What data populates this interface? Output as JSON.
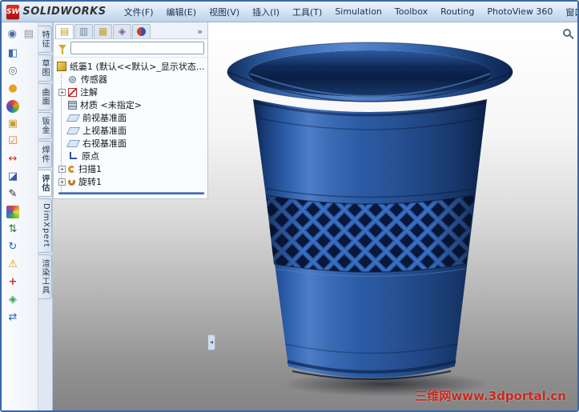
{
  "titlebar": {
    "logo_text": "SW",
    "brand": "SOLIDWORKS",
    "menus": [
      "文件(F)",
      "编辑(E)",
      "视图(V)",
      "插入(I)",
      "工具(T)",
      "Simulation",
      "Toolbox",
      "Routing",
      "PhotoView 360",
      "窗口(W)"
    ]
  },
  "left_toolbar": {
    "icons": [
      {
        "name": "pin-icon",
        "glyph": "◉"
      },
      {
        "name": "document-icon",
        "glyph": "▤"
      },
      {
        "name": "part-cube-icon",
        "glyph": "◧"
      },
      {
        "name": "target-icon",
        "glyph": "◎"
      },
      {
        "name": "appearance-icon",
        "glyph": "●"
      },
      {
        "name": "color-wheel-icon",
        "glyph": ""
      },
      {
        "name": "scene-icon",
        "glyph": "▣"
      },
      {
        "name": "options-check-icon",
        "glyph": "☑"
      },
      {
        "name": "measure-icon",
        "glyph": "↔"
      },
      {
        "name": "section-view-icon",
        "glyph": "◪"
      },
      {
        "name": "pen-icon",
        "glyph": "✎"
      },
      {
        "name": "palette-icon",
        "glyph": ""
      },
      {
        "name": "sort-arrows-icon",
        "glyph": "⇅"
      },
      {
        "name": "refresh-icon",
        "glyph": "↻"
      },
      {
        "name": "warning-icon",
        "glyph": "⚠"
      },
      {
        "name": "crosshair-icon",
        "glyph": "+"
      },
      {
        "name": "diamond-icon",
        "glyph": "◈"
      },
      {
        "name": "swap-icon",
        "glyph": "⇄"
      }
    ]
  },
  "command_tabs": {
    "items": [
      {
        "label": "特征"
      },
      {
        "label": "草图"
      },
      {
        "label": "曲面"
      },
      {
        "label": "钣金"
      },
      {
        "label": "焊件"
      },
      {
        "label": "评估"
      },
      {
        "label": "DimXpert"
      },
      {
        "label": "渲染工具"
      }
    ]
  },
  "feature_panel": {
    "tabs": [
      {
        "name": "featuremanager-tab",
        "glyph": "▤"
      },
      {
        "name": "propertymanager-tab",
        "glyph": "▥"
      },
      {
        "name": "configurationmanager-tab",
        "glyph": "▦"
      },
      {
        "name": "dimxpertmanager-tab",
        "glyph": "◈"
      },
      {
        "name": "displaymanager-tab",
        "glyph": ""
      }
    ],
    "overflow_glyph": "»",
    "filter": {
      "placeholder": ""
    },
    "tree": {
      "root": {
        "label": "纸篓1 (默认<<默认>_显示状态..."
      },
      "items": [
        {
          "label": "传感器",
          "expand": ""
        },
        {
          "label": "注解",
          "expand": "+"
        },
        {
          "label": "材质 <未指定>",
          "expand": ""
        },
        {
          "label": "前视基准面",
          "expand": ""
        },
        {
          "label": "上视基准面",
          "expand": ""
        },
        {
          "label": "右视基准面",
          "expand": ""
        },
        {
          "label": "原点",
          "expand": ""
        },
        {
          "label": "扫描1",
          "expand": "+"
        },
        {
          "label": "旋转1",
          "expand": "+"
        }
      ]
    }
  },
  "viewport": {
    "watermark": "三维网www.3dportal.cn",
    "splitter_glyph": "◂",
    "model_color": "#1d4e96"
  }
}
